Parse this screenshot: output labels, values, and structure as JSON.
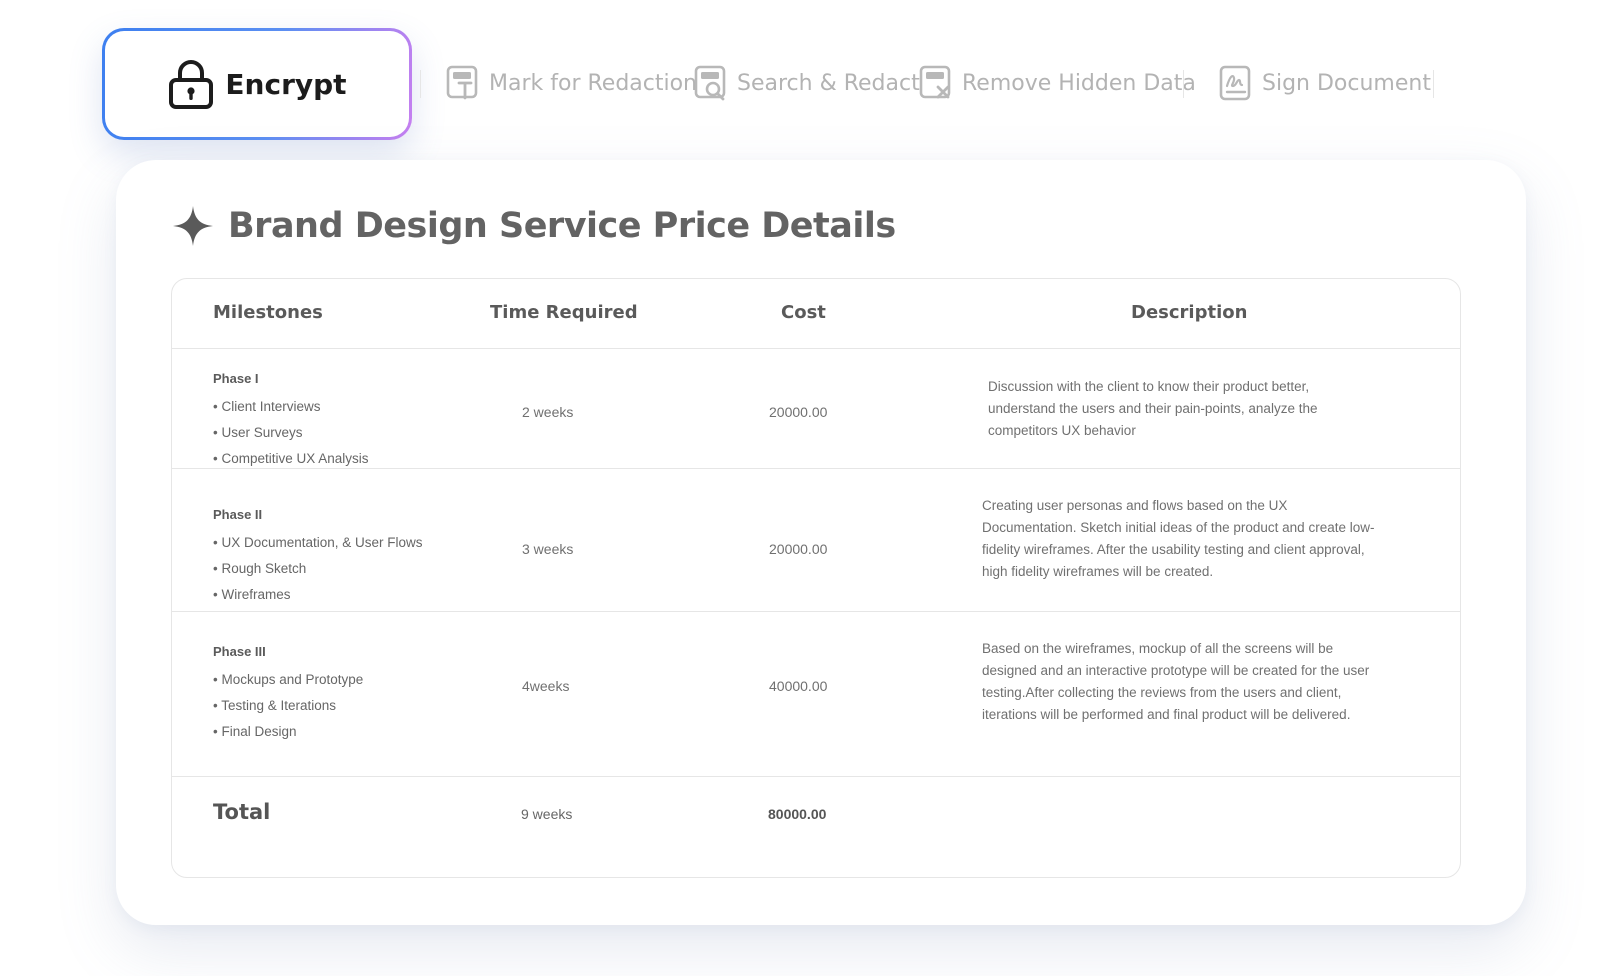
{
  "toolbar": {
    "encrypt_label": "Encrypt",
    "mark_redaction_label": "Mark for Redaction",
    "search_redact_label": "Search & Redact",
    "remove_hidden_label": "Remove Hidden Data",
    "sign_document_label": "Sign Document"
  },
  "card": {
    "title": "Brand Design Service Price Details"
  },
  "table": {
    "headers": [
      "Milestones",
      "Time Required",
      "Cost",
      "Description"
    ],
    "rows": [
      {
        "phase": "Phase I",
        "items": [
          "• Client Interviews",
          "• User Surveys",
          "• Competitive UX Analysis"
        ],
        "time": "2 weeks",
        "cost": "20000.00",
        "description": "Discussion with the client to know their product better, understand the users and their pain-points, analyze the competitors UX behavior"
      },
      {
        "phase": "Phase II",
        "items": [
          "• UX Documentation, & User Flows",
          "• Rough Sketch",
          "• Wireframes"
        ],
        "time": "3 weeks",
        "cost": "20000.00",
        "description": "Creating user personas and flows based on the UX Documentation. Sketch initial ideas of the product and create low-fidelity wireframes. After the usability testing and client approval, high fidelity wireframes will be created."
      },
      {
        "phase": "Phase III",
        "items": [
          "• Mockups and Prototype",
          "• Testing & Iterations",
          "• Final Design"
        ],
        "time": "4weeks",
        "cost": "40000.00",
        "description": "Based on the wireframes, mockup of all the screens will be designed and an interactive prototype will be created for the user testing.After collecting the reviews from the users and client, iterations will be performed and final product will be delivered."
      }
    ],
    "total": {
      "label": "Total",
      "time": "9 weeks",
      "cost": "80000.00"
    }
  },
  "colors": {
    "accent_start": "#3d7ff0",
    "accent_end": "#c77ff0",
    "muted_text": "#b3b3b3",
    "border": "#e6e6e6"
  },
  "icons": [
    "lock-icon",
    "mark-redaction-icon",
    "search-redact-icon",
    "remove-hidden-data-icon",
    "sign-document-icon",
    "sparkle-icon"
  ]
}
